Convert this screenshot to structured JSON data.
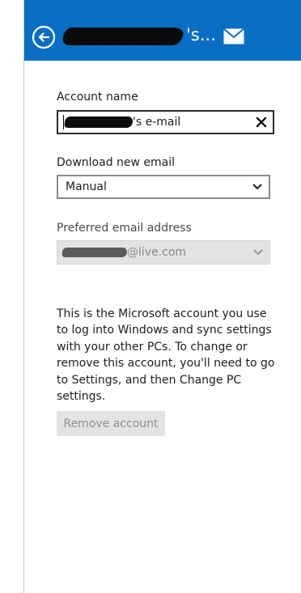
{
  "header": {
    "title_suffix": "'s...",
    "background": "#0a6fc4",
    "back_icon": "back-arrow-circle-icon",
    "mail_icon": "mail-envelope-icon"
  },
  "account_name": {
    "label": "Account name",
    "value_suffix": "'s e-mail"
  },
  "download": {
    "label": "Download new email",
    "selected": "Manual"
  },
  "preferred": {
    "label": "Preferred email address",
    "value_suffix": "@live.com"
  },
  "info": {
    "text": "This is the Microsoft account you use to log into Windows and sync settings with your other PCs. To change or remove this account, you'll need to go to Settings, and then Change PC settings."
  },
  "remove_button": {
    "label": "Remove account"
  }
}
